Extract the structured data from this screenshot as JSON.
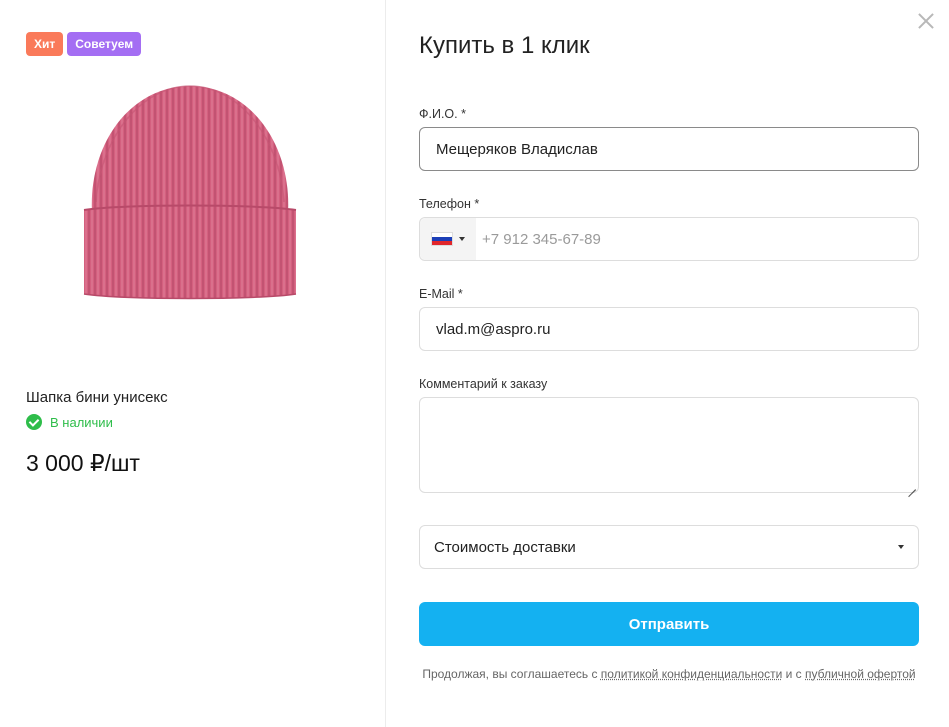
{
  "product": {
    "badges": [
      "Хит",
      "Советуем"
    ],
    "name": "Шапка бини унисекс",
    "stock": "В наличии",
    "price": "3 000 ₽/шт"
  },
  "form": {
    "title": "Купить в 1 клик",
    "name_label": "Ф.И.О. *",
    "name_value": "Мещеряков Владислав",
    "phone_label": "Телефон *",
    "phone_placeholder": "+7 912 345-67-89",
    "email_label": "E-Mail *",
    "email_value": "vlad.m@aspro.ru",
    "comment_label": "Комментарий к заказу",
    "delivery_select": "Стоимость доставки",
    "submit_label": "Отправить",
    "agreement_prefix": "Продолжая, вы соглашаетесь с ",
    "agreement_link1": "политикой конфиденциальности",
    "agreement_middle": " и с ",
    "agreement_link2": "публичной офертой"
  },
  "colors": {
    "accent": "#14b1f1",
    "badge_hit": "#fa7a5a",
    "badge_recommend": "#a46ef3",
    "in_stock": "#2ebd4a",
    "hat": "#d4607f"
  },
  "icons": [
    "close-icon",
    "check-circle-icon",
    "russia-flag-icon",
    "chevron-down-icon"
  ]
}
